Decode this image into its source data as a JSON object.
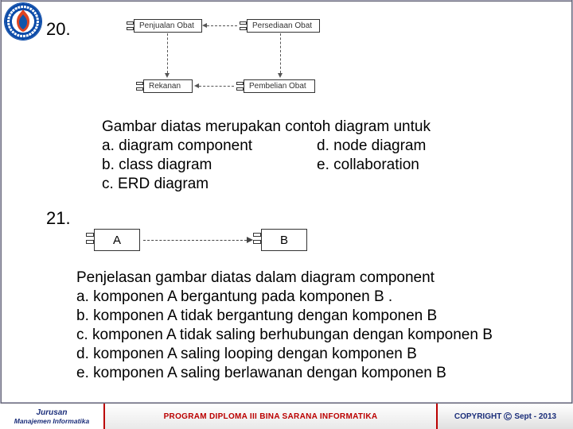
{
  "questions": {
    "q20": {
      "number": "20.",
      "diagram_boxes": {
        "tl": "Penjualan Obat",
        "tr": "Persediaan Obat",
        "bl": "Rekanan",
        "br": "Pembelian Obat"
      },
      "prompt": "Gambar diatas merupakan contoh diagram untuk",
      "options": {
        "a": "a. diagram component",
        "b": "b. class diagram",
        "c": "c. ERD diagram",
        "d": "d. node diagram",
        "e": "e. collaboration"
      }
    },
    "q21": {
      "number": "21.",
      "diagram_boxes": {
        "left": "A",
        "right": "B"
      },
      "prompt": "Penjelasan gambar diatas dalam diagram component",
      "options": {
        "a": "a. komponen A bergantung pada komponen B .",
        "b": "b. komponen A tidak bergantung dengan komponen B",
        "c": "c. komponen A tidak saling berhubungan dengan komponen B",
        "d": "d. komponen A saling looping dengan komponen B",
        "e": "e. komponen A saling berlawanan dengan komponen B"
      }
    }
  },
  "footer": {
    "dept_line1": "Jurusan",
    "dept_line2": "Manajemen Informatika",
    "program": "PROGRAM DIPLOMA III BINA SARANA INFORMATIKA",
    "copyright_label": "COPYRIGHT",
    "copyright_symbol": "C",
    "copyright_date": "Sept - 2013"
  }
}
